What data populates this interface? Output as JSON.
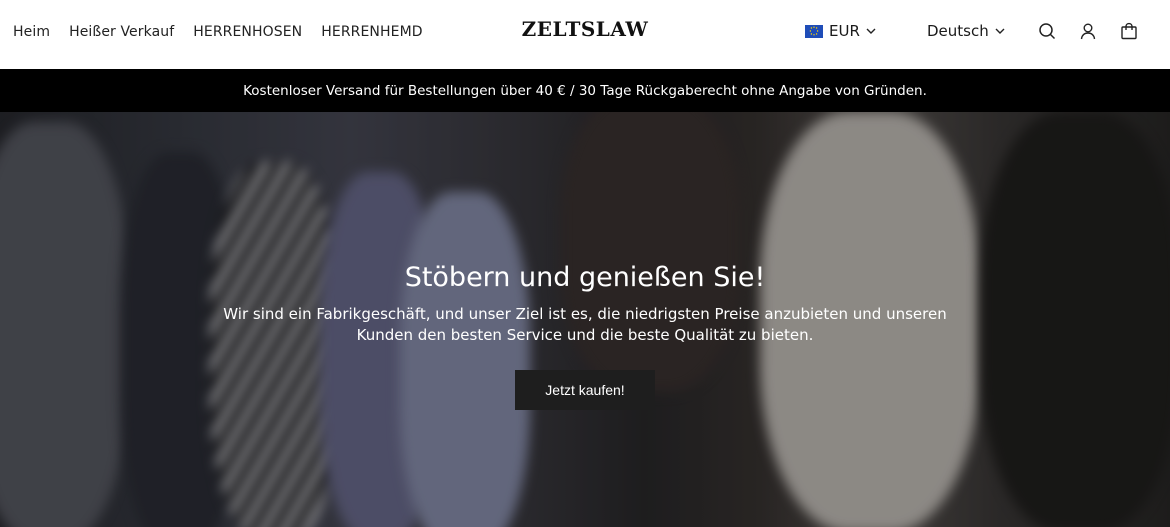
{
  "header": {
    "nav": [
      {
        "label": "Heim"
      },
      {
        "label": "Heißer Verkauf"
      },
      {
        "label": "HERRENHOSEN"
      },
      {
        "label": "HERRENHEMD"
      }
    ],
    "logo": "ZELTSLAW",
    "currency": {
      "label": "EUR",
      "flag": "eu-flag-icon"
    },
    "language": {
      "label": "Deutsch"
    },
    "icons": [
      "search-icon",
      "account-icon",
      "cart-icon"
    ]
  },
  "announcement": {
    "text": "Kostenloser Versand für Bestellungen über 40 € / 30 Tage Rückgaberecht ohne Angabe von Gründen."
  },
  "hero": {
    "title": "Stöbern und genießen Sie!",
    "text": "Wir sind ein Fabrikgeschäft, und unser Ziel ist es, die niedrigsten Preise anzubieten und unseren Kunden den besten Service und die beste Qualität zu bieten.",
    "button": "Jetzt kaufen!"
  },
  "colors": {
    "announcement_bg": "#000000",
    "button_bg": "#1e1e1e",
    "flag_blue": "#1f4db8"
  }
}
